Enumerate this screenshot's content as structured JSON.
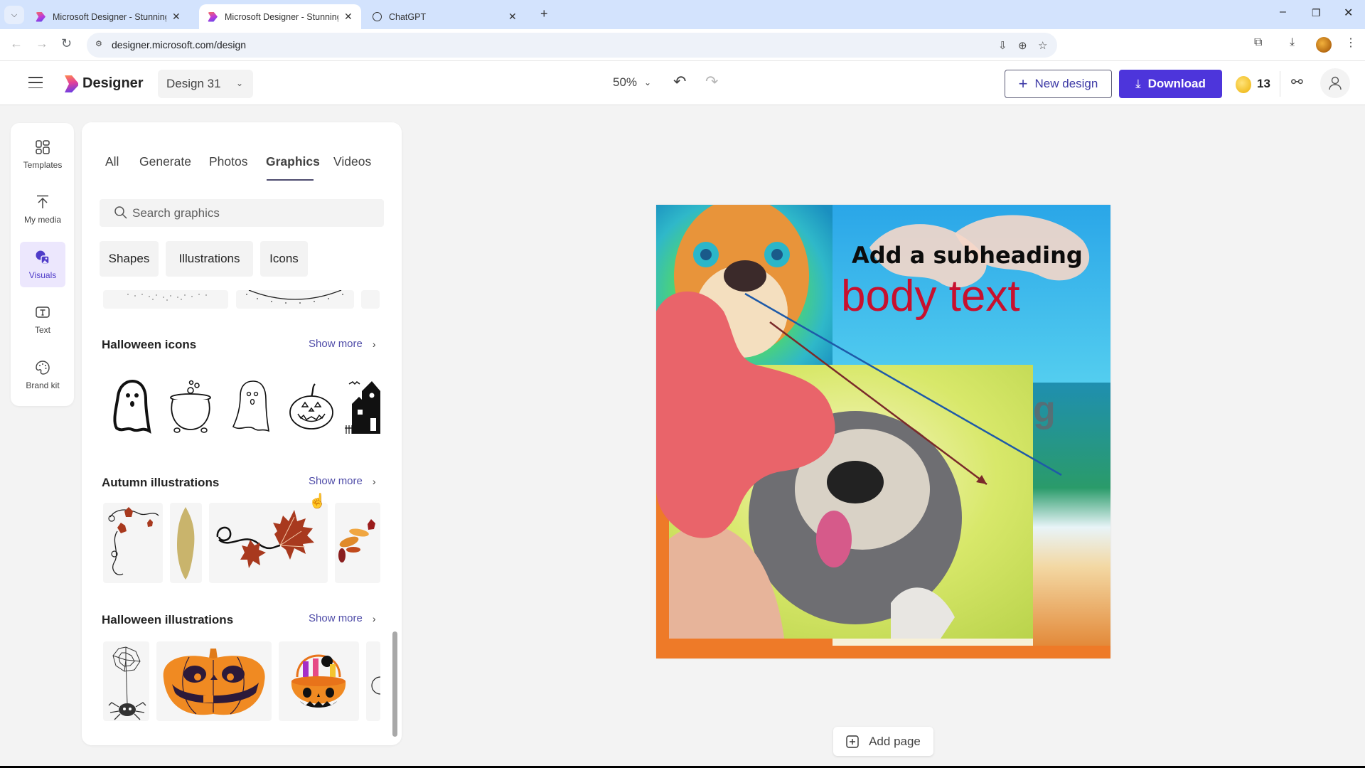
{
  "browser": {
    "tabs": [
      {
        "title": "Microsoft Designer - Stunning designs in a flash",
        "favicon": "designer-icon",
        "active": false
      },
      {
        "title": "Microsoft Designer - Stunning designs in a flash",
        "favicon": "designer-icon",
        "active": true
      },
      {
        "title": "ChatGPT",
        "favicon": "chatgpt-icon",
        "active": false
      }
    ],
    "url": "designer.microsoft.com/design",
    "window_controls": [
      "minimize",
      "restore",
      "close"
    ]
  },
  "header": {
    "brand": "Designer",
    "design_name": "Design 31",
    "zoom": "50%",
    "new_design_label": "New design",
    "download_label": "Download",
    "coins": "13"
  },
  "rail": {
    "items": [
      {
        "label": "Templates",
        "icon": "templates-icon",
        "active": false
      },
      {
        "label": "My media",
        "icon": "upload-icon",
        "active": false
      },
      {
        "label": "Visuals",
        "icon": "visuals-icon",
        "active": true
      },
      {
        "label": "Text",
        "icon": "text-icon",
        "active": false
      },
      {
        "label": "Brand kit",
        "icon": "palette-icon",
        "active": false
      }
    ]
  },
  "panel": {
    "tabs": [
      {
        "label": "All",
        "active": false
      },
      {
        "label": "Generate",
        "active": false
      },
      {
        "label": "Photos",
        "active": false
      },
      {
        "label": "Graphics",
        "active": true
      },
      {
        "label": "Videos",
        "active": false
      }
    ],
    "search_placeholder": "Search graphics",
    "chips": [
      "Shapes",
      "Illustrations",
      "Icons"
    ],
    "sections": [
      {
        "title": "Halloween icons",
        "show_more": "Show more",
        "items": [
          "ghost-bold-icon",
          "cauldron-icon",
          "ghost-outline-icon",
          "jack-o-lantern-icon",
          "haunted-house-icon"
        ]
      },
      {
        "title": "Autumn illustrations",
        "show_more": "Show more",
        "items": [
          "autumn-swirl-corner",
          "golden-foliage",
          "maple-leaves-swirl",
          "autumn-leaves-bouquet"
        ]
      },
      {
        "title": "Halloween illustrations",
        "show_more": "Show more",
        "items": [
          "spider-web",
          "carved-pumpkin",
          "pumpkin-candy-bucket",
          "halloween-partial"
        ]
      }
    ]
  },
  "canvas": {
    "subheading": "Add a subheading",
    "body_text": "body text",
    "partial_text": "g",
    "colors": {
      "blob": "#e9646a",
      "body_text": "#c8102e",
      "bottom_band": "#ee7a28"
    }
  },
  "footer": {
    "add_page_label": "Add page"
  },
  "colors": {
    "accent": "#4d35db",
    "accent_text": "#4f4ca8",
    "rail_active_bg": "#ece7fd"
  }
}
